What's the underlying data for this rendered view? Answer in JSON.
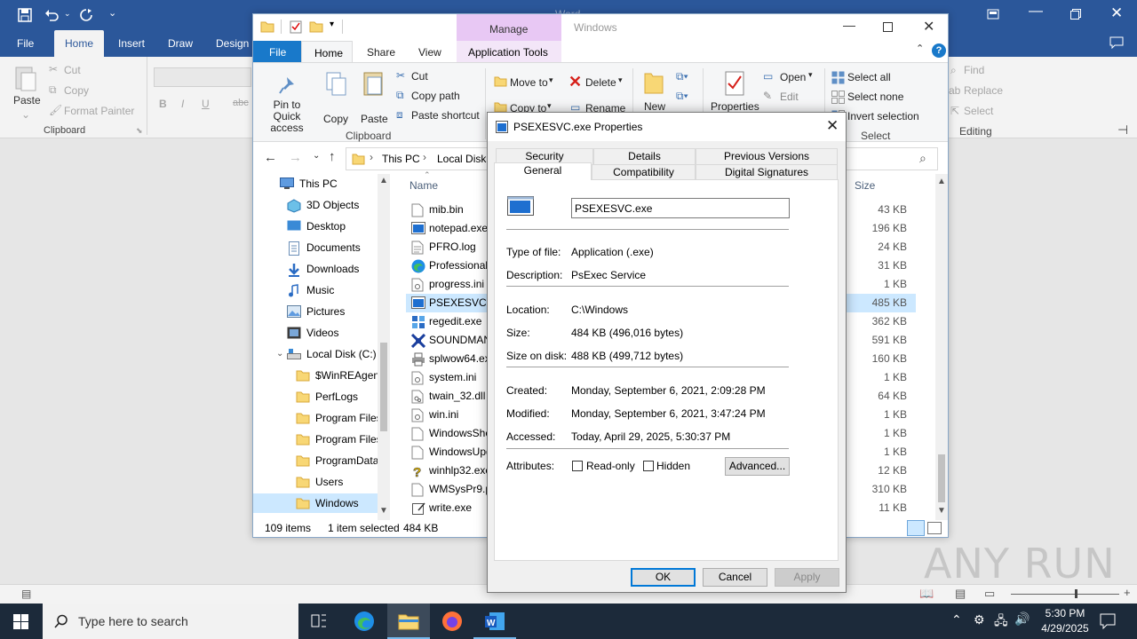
{
  "word": {
    "title": "Word",
    "tabs": [
      "File",
      "Home",
      "Insert",
      "Draw",
      "Design"
    ],
    "ribbon": {
      "paste": "Paste",
      "cut": "Cut",
      "copy": "Copy",
      "format_painter": "Format Painter",
      "clipboard": "Clipboard",
      "find": "Find",
      "replace": "Replace",
      "select": "Select",
      "editing": "Editing",
      "bold": "B",
      "italic": "I",
      "underline": "U",
      "strike": "abc"
    }
  },
  "explorer": {
    "title": "Windows",
    "manage": "Manage",
    "tabs": [
      "File",
      "Home",
      "Share",
      "View",
      "Application Tools"
    ],
    "ribbon": {
      "pin": "Pin to Quick access",
      "copy": "Copy",
      "paste": "Paste",
      "cut": "Cut",
      "copy_path": "Copy path",
      "paste_shortcut": "Paste shortcut",
      "clipboard": "Clipboard",
      "move_to": "Move to",
      "delete": "Delete",
      "copy_to": "Copy to",
      "rename": "Rename",
      "new": "New",
      "properties": "Properties",
      "open": "Open",
      "edit": "Edit",
      "select_all": "Select all",
      "select_none": "Select none",
      "invert_selection": "Invert selection",
      "select": "Select"
    },
    "breadcrumb": [
      "This PC",
      "Local Disk"
    ],
    "column_name": "Name",
    "column_size": "Size",
    "nav": [
      {
        "label": "This PC",
        "icon": "computer-icon"
      },
      {
        "label": "3D Objects",
        "icon": "cube-icon"
      },
      {
        "label": "Desktop",
        "icon": "desktop-icon"
      },
      {
        "label": "Documents",
        "icon": "document-icon"
      },
      {
        "label": "Downloads",
        "icon": "download-icon"
      },
      {
        "label": "Music",
        "icon": "music-icon"
      },
      {
        "label": "Pictures",
        "icon": "picture-icon"
      },
      {
        "label": "Videos",
        "icon": "video-icon"
      },
      {
        "label": "Local Disk (C:)",
        "icon": "drive-icon"
      },
      {
        "label": "$WinREAgent",
        "icon": "folder-icon"
      },
      {
        "label": "PerfLogs",
        "icon": "folder-icon"
      },
      {
        "label": "Program Files",
        "icon": "folder-icon"
      },
      {
        "label": "Program Files",
        "icon": "folder-icon"
      },
      {
        "label": "ProgramData",
        "icon": "folder-icon"
      },
      {
        "label": "Users",
        "icon": "folder-icon"
      },
      {
        "label": "Windows",
        "icon": "folder-icon"
      }
    ],
    "files": [
      {
        "name": "mib.bin",
        "size": "43 KB",
        "icon": "file-icon"
      },
      {
        "name": "notepad.exe",
        "size": "196 KB",
        "icon": "exe-icon"
      },
      {
        "name": "PFRO.log",
        "size": "24 KB",
        "icon": "text-file-icon"
      },
      {
        "name": "Professional.",
        "size": "31 KB",
        "icon": "edge-icon"
      },
      {
        "name": "progress.ini",
        "size": "1 KB",
        "icon": "settings-file-icon"
      },
      {
        "name": "PSEXESVC.exe",
        "size": "485 KB",
        "icon": "exe-icon"
      },
      {
        "name": "regedit.exe",
        "size": "362 KB",
        "icon": "registry-icon"
      },
      {
        "name": "SOUNDMAN",
        "size": "591 KB",
        "icon": "sound-icon"
      },
      {
        "name": "splwow64.exe",
        "size": "160 KB",
        "icon": "printer-icon"
      },
      {
        "name": "system.ini",
        "size": "1 KB",
        "icon": "settings-file-icon"
      },
      {
        "name": "twain_32.dll",
        "size": "64 KB",
        "icon": "dll-icon"
      },
      {
        "name": "win.ini",
        "size": "1 KB",
        "icon": "settings-file-icon"
      },
      {
        "name": "WindowsShe",
        "size": "1 KB",
        "icon": "file-icon"
      },
      {
        "name": "WindowsUpd",
        "size": "1 KB",
        "icon": "file-icon"
      },
      {
        "name": "winhlp32.exe",
        "size": "12 KB",
        "icon": "help-icon"
      },
      {
        "name": "WMSysPr9.p",
        "size": "310 KB",
        "icon": "file-icon"
      },
      {
        "name": "write.exe",
        "size": "11 KB",
        "icon": "write-icon"
      }
    ],
    "selected_file_index": 5,
    "status": {
      "items": "109 items",
      "selected": "1 item selected",
      "size": "484 KB"
    }
  },
  "dialog": {
    "title": "PSEXESVC.exe Properties",
    "tabs_row1": [
      "Security",
      "Details",
      "Previous Versions"
    ],
    "tabs_row2": [
      "General",
      "Compatibility",
      "Digital Signatures"
    ],
    "filename": "PSEXESVC.exe",
    "fields": [
      {
        "label": "Type of file:",
        "value": "Application (.exe)"
      },
      {
        "label": "Description:",
        "value": "PsExec Service"
      },
      {
        "label": "Location:",
        "value": "C:\\Windows"
      },
      {
        "label": "Size:",
        "value": "484 KB (496,016 bytes)"
      },
      {
        "label": "Size on disk:",
        "value": "488 KB (499,712 bytes)"
      },
      {
        "label": "Created:",
        "value": "Monday, September 6, 2021, 2:09:28 PM"
      },
      {
        "label": "Modified:",
        "value": "Monday, September 6, 2021, 3:47:24 PM"
      },
      {
        "label": "Accessed:",
        "value": "Today, April 29, 2025, 5:30:37 PM"
      }
    ],
    "attributes_label": "Attributes:",
    "read_only": "Read-only",
    "hidden": "Hidden",
    "advanced": "Advanced...",
    "ok": "OK",
    "cancel": "Cancel",
    "apply": "Apply"
  },
  "taskbar": {
    "search_placeholder": "Type here to search",
    "time": "5:30 PM",
    "date": "4/29/2025"
  },
  "watermark": "ANY RUN",
  "colors": {
    "word_blue": "#2b579a",
    "selection": "#cce8ff",
    "manage_tab": "#e8c8f4",
    "taskbar": "#1c2a3a"
  }
}
